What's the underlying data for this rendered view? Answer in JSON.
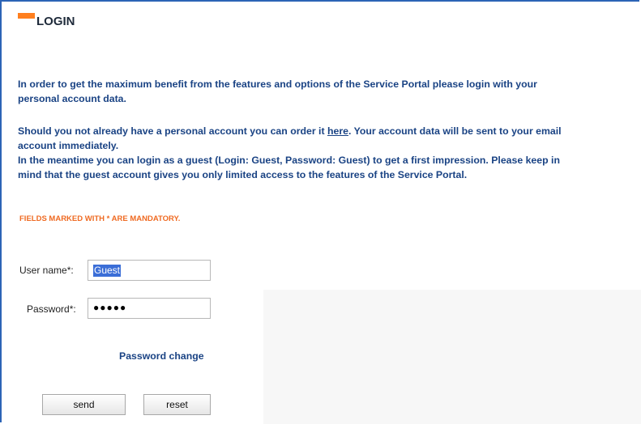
{
  "header": {
    "title": "LOGIN",
    "accent_color": "#ff7f1e"
  },
  "intro": {
    "line1": "In order to get the maximum benefit from the features and options of the Service Portal please login with your",
    "line2": "personal account data."
  },
  "account_info": {
    "line1_before_link": "Should you not already have a personal account you can order it ",
    "link_text": "here",
    "line1_after_link": ". Your account data will be sent to your email",
    "line2": "account immediately.",
    "line3": "In the meantime you can login as a guest (Login: Guest, Password: Guest)  to get a first impression. Please keep in",
    "line4": "mind that the guest account gives you only limited access to the features of the Service Portal."
  },
  "mandatory_note": "FIELDS MARKED WITH * ARE MANDATORY.",
  "form": {
    "username_label": "User name*:",
    "username_value": "Guest",
    "password_label": "Password*:",
    "password_mask": "●●●●●",
    "password_change": "Password change",
    "send_label": "send",
    "reset_label": "reset"
  },
  "colors": {
    "text_blue": "#1a4384",
    "mandatory_orange": "#ef6a22",
    "selection_blue": "#3b6ed7"
  }
}
